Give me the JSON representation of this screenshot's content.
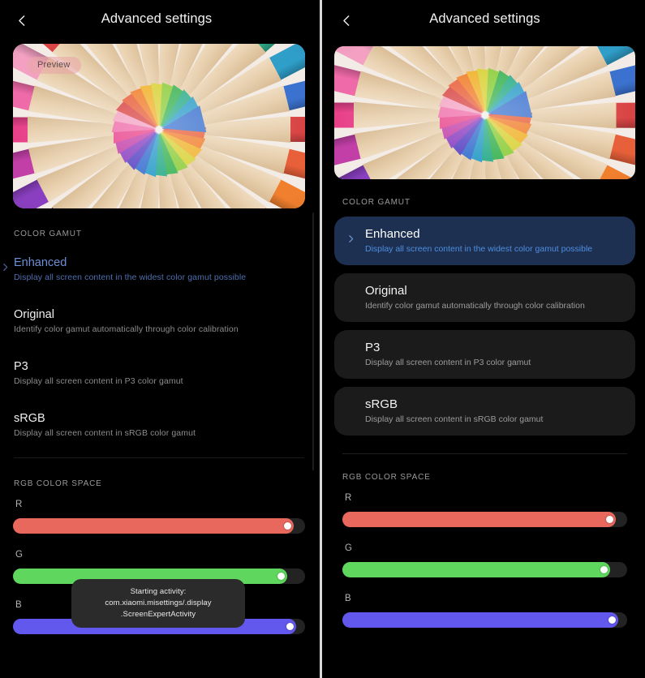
{
  "screen": {
    "title": "Advanced settings",
    "back_icon": "chevron-left-icon",
    "preview_badge": "Preview"
  },
  "sections": {
    "color_gamut_label": "COLOR GAMUT",
    "rgb_label": "RGB COLOR SPACE"
  },
  "gamut_options": [
    {
      "title": "Enhanced",
      "subtitle": "Display all screen content in the widest color gamut possible",
      "selected": true,
      "chevron": "chevron-right-icon"
    },
    {
      "title": "Original",
      "subtitle": "Identify color gamut automatically through color calibration",
      "selected": false,
      "chevron": "chevron-right-icon"
    },
    {
      "title": "P3",
      "subtitle": "Display all screen content in P3 color gamut",
      "selected": false,
      "chevron": "chevron-right-icon"
    },
    {
      "title": "sRGB",
      "subtitle": "Display all screen content in sRGB color gamut",
      "selected": false,
      "chevron": "chevron-right-icon"
    }
  ],
  "sliders": [
    {
      "label": "R",
      "color": "#e8685e",
      "value": 96
    },
    {
      "label": "G",
      "color": "#5fd75f",
      "value": 94
    },
    {
      "label": "B",
      "color": "#6358ee",
      "value": 97
    }
  ],
  "toast": {
    "line1": "Starting activity: com.xiaomi.misettings/.display",
    "line2": ".ScreenExpertActivity"
  },
  "colors": {
    "background": "#000000",
    "card": "#1b1b1b",
    "card_selected": "#1d3051",
    "accent_blue": "#4d8ee0",
    "accent_blue_dim": "#6d8fd6",
    "text_primary": "#f2f2f2",
    "text_secondary": "#9b9b9b",
    "divider": "#d8d8d8"
  },
  "pencils": [
    "#d94444",
    "#e8603a",
    "#f07f2e",
    "#f0b22c",
    "#d9d23a",
    "#8fce3f",
    "#3eb457",
    "#2fae8c",
    "#2f9ec9",
    "#3b72cf",
    "#5a46c4",
    "#8a3fc0",
    "#c23fa8",
    "#e8418a",
    "#ef6aa8",
    "#f3a0c2"
  ]
}
